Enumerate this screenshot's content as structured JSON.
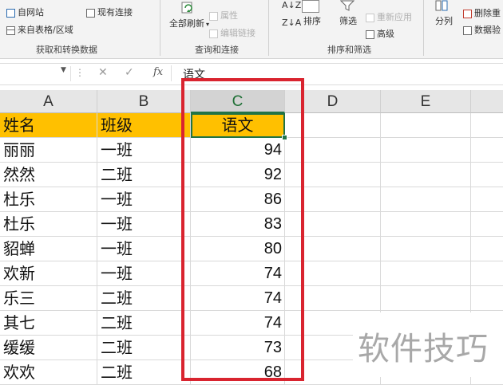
{
  "ribbon": {
    "get_transform": {
      "from_web": "自网站",
      "from_table": "来自表格/区域",
      "existing_connections": "现有连接",
      "group_label": "获取和转换数据"
    },
    "queries_connections": {
      "refresh_all": "全部刷新",
      "properties": "属性",
      "edit_links": "编辑链接",
      "group_label": "查询和连接"
    },
    "sort_filter": {
      "sort_az": "A↓Z",
      "sort_za": "Z↓A",
      "sort": "排序",
      "filter": "筛选",
      "reapply": "重新应用",
      "advanced": "高级",
      "group_label": "排序和筛选"
    },
    "data_tools": {
      "text_to_columns": "分列",
      "remove_duplicates": "删除重",
      "data_validation": "数据验"
    }
  },
  "formula_bar": {
    "name_box": "",
    "cancel_icon": "✕",
    "enter_icon": "✓",
    "fx_label": "fx",
    "content": "语文"
  },
  "sheet": {
    "columns": [
      "A",
      "B",
      "C",
      "D",
      "E"
    ],
    "selected_column": "C",
    "header": {
      "name": "姓名",
      "class": "班级",
      "chinese": "语文"
    },
    "rows": [
      {
        "name": "丽丽",
        "class": "一班",
        "chinese": "94"
      },
      {
        "name": "然然",
        "class": "二班",
        "chinese": "92"
      },
      {
        "name": "杜乐",
        "class": "一班",
        "chinese": "86"
      },
      {
        "name": "杜乐",
        "class": "一班",
        "chinese": "83"
      },
      {
        "name": "貂蝉",
        "class": "一班",
        "chinese": "80"
      },
      {
        "name": "欢新",
        "class": "一班",
        "chinese": "74"
      },
      {
        "name": "乐三",
        "class": "二班",
        "chinese": "74"
      },
      {
        "name": "其七",
        "class": "二班",
        "chinese": "74"
      },
      {
        "name": "缓缓",
        "class": "二班",
        "chinese": "73"
      },
      {
        "name": "欢欢",
        "class": "二班",
        "chinese": "68"
      }
    ]
  },
  "watermark": "软件技巧",
  "colors": {
    "header_fill": "#ffc000",
    "highlight_box": "#d9242f",
    "selection": "#217346"
  }
}
